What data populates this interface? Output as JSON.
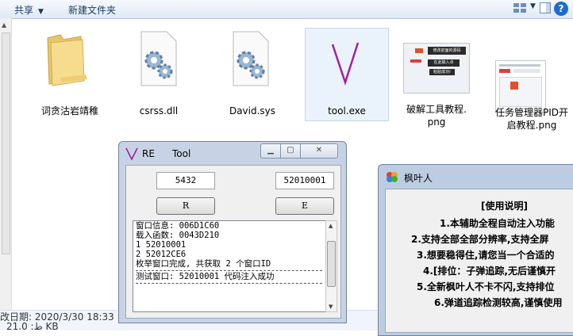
{
  "toolbar": {
    "share_label": "共享",
    "new_folder_label": "新建文件夹",
    "help": "?"
  },
  "files": [
    {
      "name": "词贪沽岩靖稚",
      "type": "folder"
    },
    {
      "name": "csrss.dll",
      "type": "dll"
    },
    {
      "name": "David.sys",
      "type": "sys"
    },
    {
      "name": "tool.exe",
      "type": "exe"
    },
    {
      "name_l1": "破解工具教程.",
      "name_l2": "png",
      "type": "png"
    },
    {
      "name_l1": "任务管理器PID开",
      "name_l2": "启教程.png",
      "type": "png"
    }
  ],
  "thumb1": {
    "b1": "修改前面的源码",
    "b2": "在此输入点",
    "b3": "粘贴成功!"
  },
  "status": {
    "line1": "改日期: 2020/3/30 18:33",
    "line2": "ط: 21.0 KB"
  },
  "re_tool": {
    "title_a": "RE",
    "title_b": "Tool",
    "input1": "5432",
    "input2": "52010001",
    "btn_r": "R",
    "btn_e": "E",
    "log": [
      "窗口信息: 006D1C60",
      "载入函数: 0043D210",
      "1 52010001",
      "2 52012CE6",
      "枚举窗口完成, 共获取 2 个窗口ID",
      "测试窗口: 52010001 代码注入成功"
    ]
  },
  "maple": {
    "title": "枫叶人",
    "lines": [
      "[使用说明]",
      "1.本辅助全程自动注入功能",
      "2.支持全部全部分辨率,支持全屏",
      "3.想要稳得住,请您当一个合适的",
      "4.[排位：子弹追踪,无后谨慎开",
      "5.全新枫叶人不卡不闪,支持排位",
      "6.弹道追踪检测较高,谨慎使用"
    ]
  },
  "colors": {
    "accent": "#1f6bd0",
    "exe_logo": "#a020a0"
  }
}
